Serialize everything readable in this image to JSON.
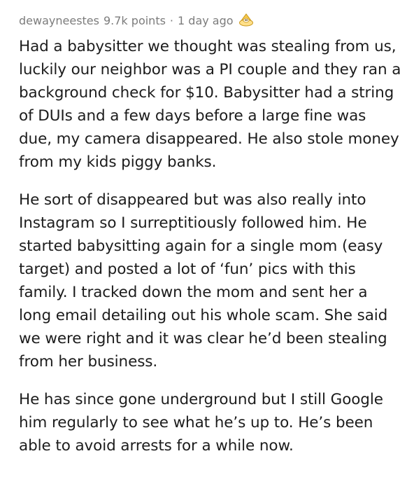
{
  "comment": {
    "author": "dewayneestes",
    "points": "9.7k points",
    "separator": "·",
    "time": "1 day ago",
    "award_icon": "gold-award-icon",
    "award_color": "#f5c84b",
    "paragraphs": [
      "Had a babysitter we thought was stealing from us, luckily our neighbor was a PI couple and they ran a background check for $10. Babysitter had a string of DUIs and a few days before a large fine was due, my camera disappeared. He also stole money from my kids piggy banks.",
      "He sort of disappeared but was also really into Instagram so I surreptitiously followed him. He started babysitting again for a single mom (easy target) and posted a lot of ‘fun’ pics with this family. I tracked down the mom and sent her a long email detailing out his whole scam. She said we were right and it was clear he’d been stealing from her business.",
      "He has since gone underground but I still Google him regularly to see what he’s up to. He’s been able to avoid arrests for a while now."
    ]
  }
}
